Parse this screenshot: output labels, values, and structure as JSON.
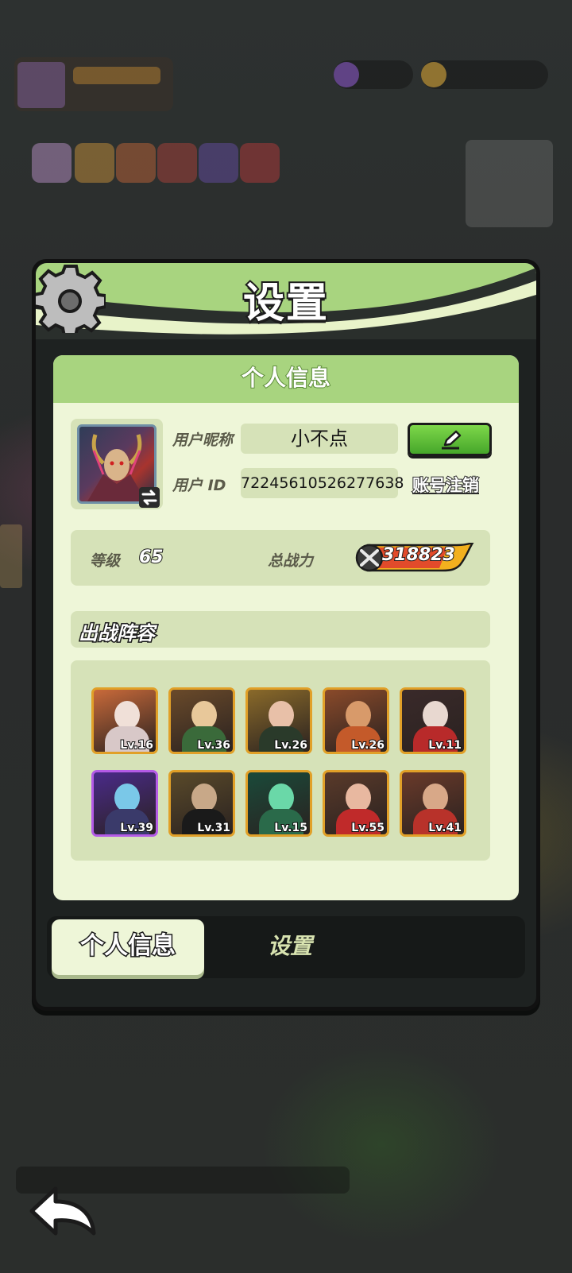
{
  "panel": {
    "title": "设置"
  },
  "profile": {
    "section_title": "个人信息",
    "nickname_label": "用户昵称",
    "nickname": "小不点",
    "id_label": "用户 ID",
    "user_id": "72245610526277638",
    "cancel_account": "账号注销",
    "level_label": "等级",
    "level": "65",
    "power_label": "总战力",
    "power": "318823"
  },
  "lineup": {
    "title": "出战阵容",
    "heroes": [
      {
        "level": "Lv.16",
        "frame": "gold"
      },
      {
        "level": "Lv.36",
        "frame": "gold"
      },
      {
        "level": "Lv.26",
        "frame": "gold"
      },
      {
        "level": "Lv.26",
        "frame": "gold"
      },
      {
        "level": "Lv.11",
        "frame": "gold"
      },
      {
        "level": "Lv.39",
        "frame": "purple"
      },
      {
        "level": "Lv.31",
        "frame": "gold"
      },
      {
        "level": "Lv.15",
        "frame": "gold"
      },
      {
        "level": "Lv.55",
        "frame": "gold"
      },
      {
        "level": "Lv.41",
        "frame": "gold"
      }
    ]
  },
  "tabs": [
    {
      "label": "个人信息",
      "active": true
    },
    {
      "label": "设置",
      "active": false
    }
  ],
  "colors": {
    "header_green": "#a8d47f",
    "card_bg": "#eef6d8",
    "field_bg": "#d6e2b8",
    "button_green": "#5cbf38",
    "frame_gold": "#e1a028",
    "frame_purple": "#b45be6"
  },
  "icons": [
    "gear-icon",
    "edit-pencil-icon",
    "swap-avatar-icon",
    "power-swords-icon",
    "back-arrow-icon"
  ]
}
